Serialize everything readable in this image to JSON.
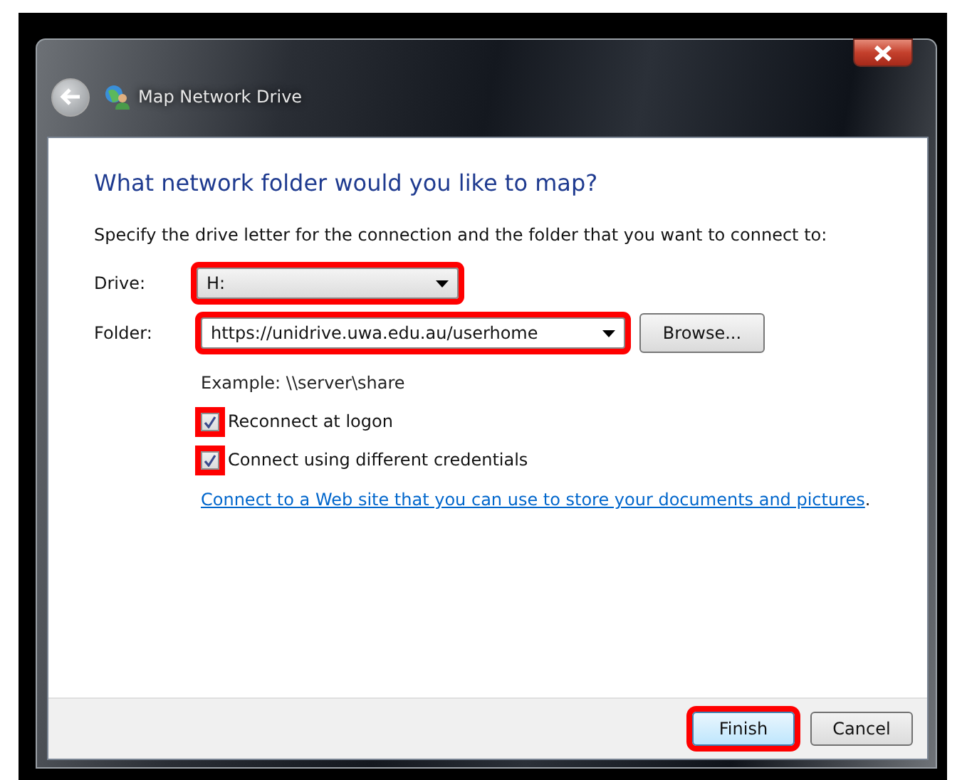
{
  "window": {
    "title": "Map Network Drive"
  },
  "heading": "What network folder would you like to map?",
  "instruction": "Specify the drive letter for the connection and the folder that you want to connect to:",
  "drive": {
    "label": "Drive:",
    "value": "H:",
    "highlighted": true
  },
  "folder": {
    "label": "Folder:",
    "value": "https://unidrive.uwa.edu.au/userhome",
    "highlighted": true
  },
  "browse_button": "Browse...",
  "example": "Example: \\\\server\\share",
  "options": [
    {
      "label": "Reconnect at logon",
      "checked": true,
      "highlighted": true
    },
    {
      "label": "Connect using different credentials",
      "checked": true,
      "highlighted": true
    }
  ],
  "link": "Connect to a Web site that you can use to store your documents and pictures",
  "link_suffix": ".",
  "buttons": [
    {
      "label": "Finish",
      "highlighted": true,
      "default": true
    },
    {
      "label": "Cancel",
      "highlighted": false,
      "default": false
    }
  ]
}
